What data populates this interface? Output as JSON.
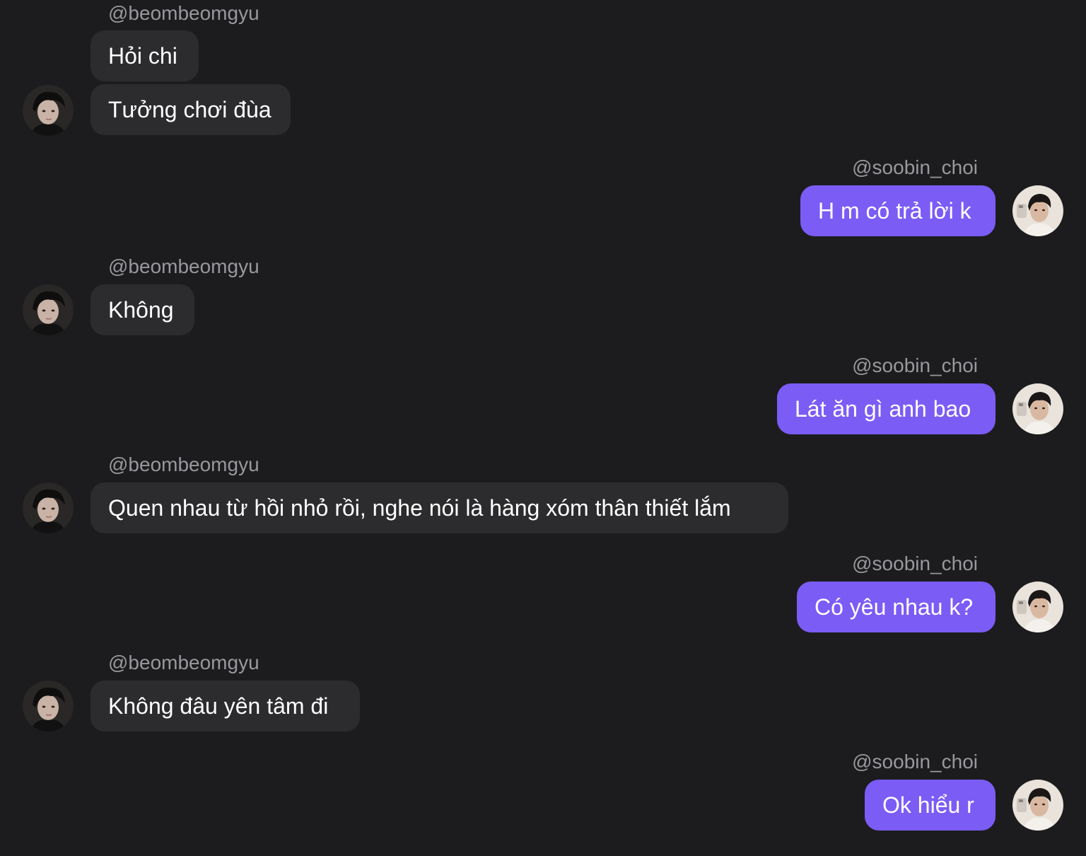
{
  "users": {
    "other": "@beombeomgyu",
    "self": "@soobin_choi"
  },
  "avatars": {
    "other": "avatar-beombeomgyu",
    "self": "avatar-soobin_choi"
  },
  "colors": {
    "background": "#1c1c1e",
    "incoming_bubble": "#2c2c2e",
    "outgoing_bubble": "#7b5cf5",
    "username_text": "#98989d"
  },
  "messages": [
    {
      "sender": "@beombeomgyu",
      "text": "Hỏi chi"
    },
    {
      "sender": "@beombeomgyu",
      "text": "Tưởng chơi đùa"
    },
    {
      "sender": "@soobin_choi",
      "text": "H m có trả lời k"
    },
    {
      "sender": "@beombeomgyu",
      "text": "Không"
    },
    {
      "sender": "@soobin_choi",
      "text": "Lát ăn gì anh bao"
    },
    {
      "sender": "@beombeomgyu",
      "text": "Quen nhau từ hồi nhỏ rồi, nghe nói là hàng xóm thân thiết lắm"
    },
    {
      "sender": "@soobin_choi",
      "text": "Có yêu nhau k?"
    },
    {
      "sender": "@beombeomgyu",
      "text": "Không đâu yên tâm đi"
    },
    {
      "sender": "@soobin_choi",
      "text": "Ok hiểu r"
    }
  ]
}
